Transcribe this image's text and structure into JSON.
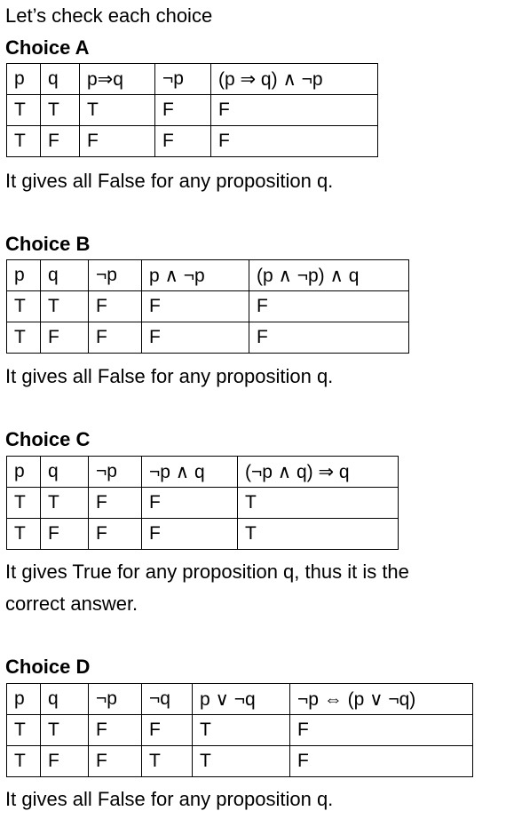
{
  "intro": "Let’s check each choice",
  "choices": [
    {
      "heading": "Choice A",
      "table": {
        "headers": [
          "p",
          "q",
          "p⇒q",
          "¬p",
          "(p ⇒ q) ∧ ¬p"
        ],
        "rows": [
          [
            "T",
            "T",
            "T",
            "F",
            "F"
          ],
          [
            "T",
            "F",
            "F",
            "F",
            "F"
          ]
        ]
      },
      "note": "It gives all False for any proposition q."
    },
    {
      "heading": "Choice B",
      "table": {
        "headers": [
          "p",
          "q",
          "¬p",
          "p ∧ ¬p",
          "(p ∧ ¬p) ∧ q"
        ],
        "rows": [
          [
            "T",
            "T",
            "F",
            "F",
            "F"
          ],
          [
            "T",
            "F",
            "F",
            "F",
            "F"
          ]
        ]
      },
      "note": "It gives all False for any proposition q."
    },
    {
      "heading": "Choice C",
      "table": {
        "headers": [
          "p",
          "q",
          "¬p",
          "¬p ∧ q",
          "(¬p ∧ q) ⇒ q"
        ],
        "rows": [
          [
            "T",
            "T",
            "F",
            "F",
            "T"
          ],
          [
            "T",
            "F",
            "F",
            "F",
            "T"
          ]
        ]
      },
      "note_lines": [
        "It gives True for any proposition q, thus it is the",
        "correct answer."
      ]
    },
    {
      "heading": "Choice D",
      "table": {
        "headers": [
          "p",
          "q",
          "¬p",
          "¬q",
          "p ∨ ¬q",
          "¬p ⇔ (p ∨ ¬q)"
        ],
        "rows": [
          [
            "T",
            "T",
            "F",
            "F",
            "T",
            "F"
          ],
          [
            "T",
            "F",
            "F",
            "T",
            "T",
            "F"
          ]
        ]
      },
      "note": "It gives all False for any proposition q."
    }
  ]
}
